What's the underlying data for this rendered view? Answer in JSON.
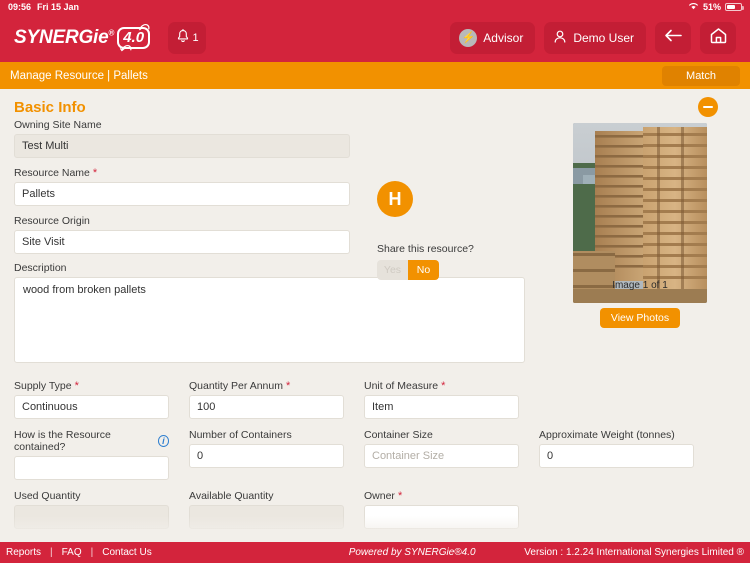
{
  "statusbar": {
    "time": "09:56",
    "date": "Fri 15 Jan",
    "battery_percent": "51%",
    "wifi_icon": "wifi-icon",
    "battery_icon": "battery-icon"
  },
  "appbar": {
    "logo_text": "SYNERGie",
    "logo_registered": "®",
    "logo_version": "4.0",
    "notification_count": "1",
    "bell_icon": "bell-icon",
    "advisor_label": "Advisor",
    "advisor_icon": "lightning-bolt-icon",
    "user_label": "Demo User",
    "user_icon": "person-icon",
    "back_icon": "arrow-left-icon",
    "home_icon": "home-icon"
  },
  "breadcrumb": {
    "text": "Manage Resource | Pallets",
    "match_label": "Match"
  },
  "section": {
    "title": "Basic Info",
    "collapse_icon": "minus-circle-icon"
  },
  "form": {
    "owning_site": {
      "label": "Owning Site Name",
      "value": "Test Multi",
      "required": false
    },
    "resource_name": {
      "label": "Resource Name",
      "value": "Pallets",
      "required": true
    },
    "resource_origin": {
      "label": "Resource Origin",
      "value": "Site Visit",
      "required": false
    },
    "description": {
      "label": "Description",
      "value": "wood from broken pallets",
      "required": false
    },
    "supply_type": {
      "label": "Supply Type",
      "value": "Continuous",
      "required": true
    },
    "quantity_per_annum": {
      "label": "Quantity Per Annum",
      "value": "100",
      "required": true
    },
    "unit_of_measure": {
      "label": "Unit of Measure",
      "value": "Item",
      "required": true
    },
    "resource_contained": {
      "label": "How is the Resource contained?",
      "value": "",
      "required": false,
      "info_icon": "info-icon"
    },
    "number_of_containers": {
      "label": "Number of Containers",
      "value": "0",
      "required": false
    },
    "container_size": {
      "label": "Container Size",
      "value": "",
      "placeholder": "Container Size",
      "required": false
    },
    "approximate_weight": {
      "label": "Approximate Weight (tonnes)",
      "value": "0",
      "required": false
    },
    "used_quantity": {
      "label": "Used Quantity",
      "value": "",
      "required": false
    },
    "available_quantity": {
      "label": "Available Quantity",
      "value": "",
      "required": false
    },
    "owner": {
      "label": "Owner",
      "value": "",
      "required": true
    }
  },
  "share": {
    "badge_letter": "H",
    "label": "Share this resource?",
    "yes_label": "Yes",
    "no_label": "No",
    "selected": "No"
  },
  "photo": {
    "caption": "Image 1 of 1",
    "view_photos_label": "View Photos",
    "alt": "stacked-wooden-pallets-photo"
  },
  "footer": {
    "reports": "Reports",
    "faq": "FAQ",
    "contact": "Contact Us",
    "separator": "|",
    "powered_by": "Powered by SYNERGie®4.0",
    "version": "Version : 1.2.24  International Synergies Limited ®"
  },
  "colors": {
    "brand_red": "#d3243c",
    "brand_orange": "#f29100",
    "required_red": "#d3243c",
    "info_blue": "#2f7fd0",
    "page_bg": "#f2efea"
  }
}
